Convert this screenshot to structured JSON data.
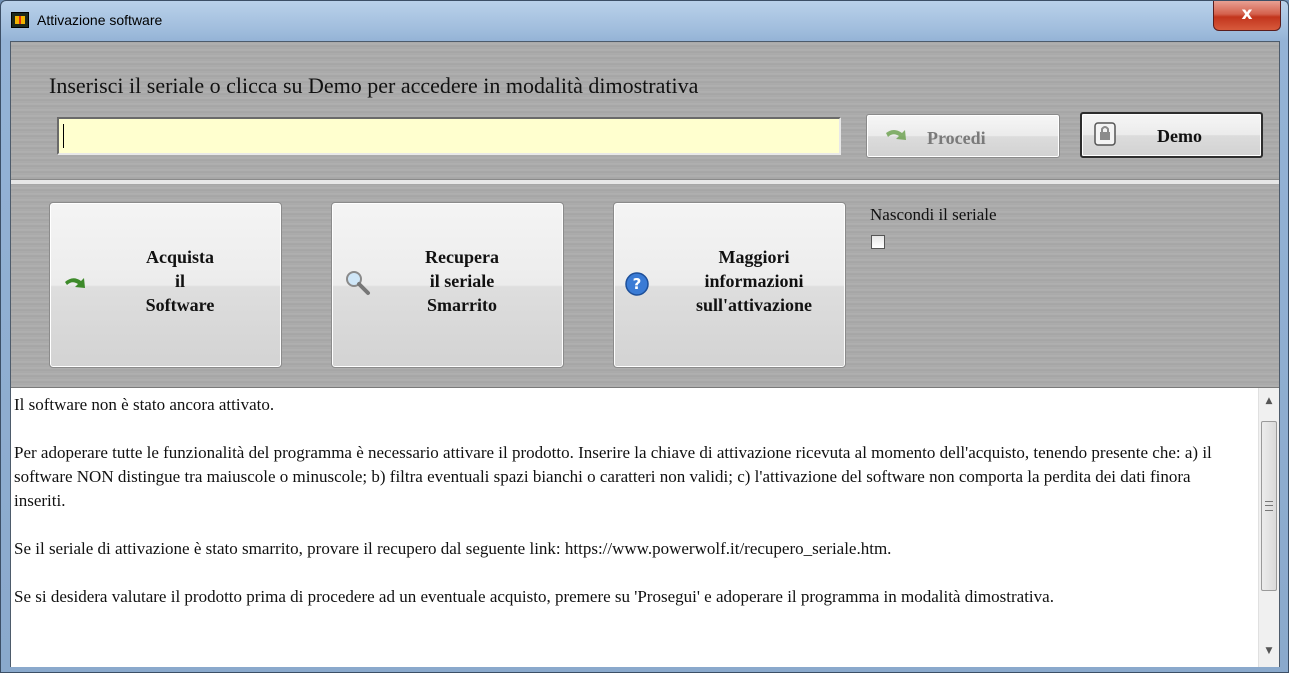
{
  "window": {
    "title": "Attivazione software",
    "close_symbol": "x"
  },
  "header": {
    "instruction": "Inserisci il seriale o clicca su Demo per accedere in modalità dimostrativa"
  },
  "serial": {
    "value": ""
  },
  "buttons": {
    "procedi_label": "Procedi",
    "procedi_enabled": false,
    "demo_label": "Demo"
  },
  "actions": {
    "buy": {
      "line1": "Acquista",
      "line2": "il",
      "line3": "Software"
    },
    "recover": {
      "line1": "Recupera",
      "line2": "il seriale",
      "line3": "Smarrito"
    },
    "info": {
      "line1": "Maggiori",
      "line2": "informazioni",
      "line3": "sull'attivazione"
    }
  },
  "options": {
    "hide_serial_label": "Nascondi il seriale",
    "hide_serial_checked": false
  },
  "message": {
    "p1": "Il software non è stato ancora attivato.",
    "p2": "Per adoperare tutte le funzionalità del programma è necessario attivare il prodotto. Inserire la chiave di attivazione ricevuta al momento dell'acquisto, tenendo presente che: a) il software NON distingue tra maiuscole o minuscole; b) filtra eventuali spazi bianchi o caratteri non validi; c) l'attivazione del software non comporta la perdita dei dati finora inseriti.",
    "p3": "Se il seriale di attivazione è stato smarrito, provare il recupero dal seguente link:  https://www.powerwolf.it/recupero_seriale.htm.",
    "p4": "Se si desidera valutare il prodotto prima di procedere ad un eventuale acquisto, premere su 'Prosegui' e adoperare il programma in modalità dimostrativa."
  },
  "icons": {
    "app": "labview-app-icon",
    "procedi": "green-arrow-icon",
    "demo": "lock-icon",
    "buy": "green-arrow-icon",
    "recover": "magnifier-icon",
    "info": "question-icon"
  }
}
